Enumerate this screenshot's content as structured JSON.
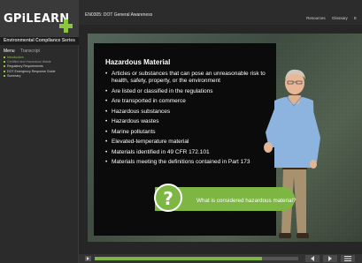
{
  "sidebar": {
    "logo_text": "GPiLEARN",
    "series": "Environmental Compliance Series",
    "tabs": [
      "Menu",
      "Transcript"
    ],
    "items": [
      {
        "label": "Introduction",
        "state": "current"
      },
      {
        "label": "Certified and Hazardous Waste",
        "state": "dim"
      },
      {
        "label": "Regulatory Requirements",
        "state": "normal"
      },
      {
        "label": "DOT Emergency Response Guide",
        "state": "normal"
      },
      {
        "label": "Summary",
        "state": "normal"
      }
    ]
  },
  "header": {
    "course_title": "EN0305: DOT General Awareness",
    "links": [
      "Resources",
      "Glossary",
      "E"
    ]
  },
  "slide": {
    "title": "Hazardous Material",
    "bullets": [
      "Articles or substances that can pose an unreasonable risk to health, safety, property, or the environment",
      "Are listed or classified in the regulations",
      "Are transported in commerce",
      "Hazardous substances",
      "Hazardous wastes",
      "Marine pollutants",
      "Elevated-temperature material",
      "Materials identified in 49 CFR 172.101",
      "Materials meeting the definitions contained in Part 173"
    ],
    "question_mark": "?",
    "question": "What is considered hazardous material?"
  },
  "player": {
    "progress": 0.82
  },
  "colors": {
    "accent": "#7db643",
    "panel": "#0b0b0b"
  }
}
